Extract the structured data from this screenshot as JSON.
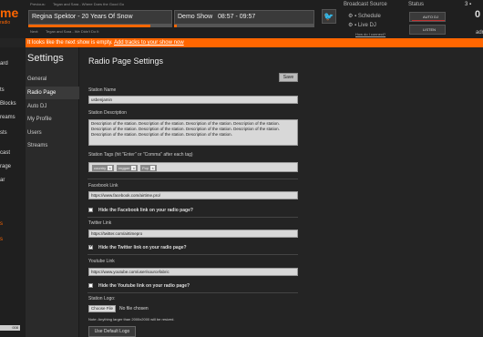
{
  "header": {
    "logo_text": "me",
    "logo_sub": "radio",
    "previous_label": "Previous:",
    "previous_track": "Tegan and Sara - Where Does the Good Go",
    "now_playing": "Regina Spektor - 20 Years Of Snow",
    "now_progress": 0.85,
    "show_name": "Demo Show",
    "show_time": "08:57 - 09:57",
    "show_progress": 0.02,
    "next_label": "Next:",
    "next_track": "Tegan and Sara - We Didn't Do It",
    "twitter_icon": "twitter-icon",
    "broadcast_source_label": "Broadcast Source",
    "schedule_label": "Schedule",
    "live_dj_label": "Live DJ",
    "howto_link": "How do I connect?",
    "status_label": "Status",
    "auto_dj_label": "AUTO DJ",
    "listen_label": "LISTEN",
    "user_count": "3",
    "listener_count": "0",
    "ad_text": "adr"
  },
  "notice": {
    "text": "It looks like the next show is empty.",
    "link": "Add tracks to your show now"
  },
  "sidebar": {
    "items": [
      "ard",
      "",
      "ts",
      "Blocks",
      "reams",
      "sts",
      "",
      "cast",
      "rage",
      "ar",
      "",
      "",
      "s",
      "s"
    ],
    "bottom_value": "008"
  },
  "subnav": {
    "title": "Settings",
    "items": [
      "General",
      "Radio Page",
      "Auto DJ",
      "My Profile",
      "Users",
      "Streams"
    ]
  },
  "page": {
    "title": "Radio Page Settings",
    "save_label": "Save",
    "station_name_label": "Station Name",
    "station_name_value": "usbenjamin",
    "station_description_label": "Station Description",
    "station_description_value": "Description of the station. Description of the station. Description of the station. Description of the station. Description of the station. Description of the station. Description of the station. Description of the station. Description of the station. Description of the station. Description of the station.",
    "station_tags_label": "Station Tags (hit \"Enter\" or \"Comma\" after each tag)",
    "tags": [
      "country",
      "reggae",
      "Pop"
    ],
    "facebook_label": "Facebook Link",
    "facebook_value": "https://www.facebook.com/airtime.pro/",
    "facebook_hide_label": "Hide the Facebook link on your radio page?",
    "twitter_label": "Twitter Link",
    "twitter_value": "https://twitter.com/airtimepro",
    "twitter_hide_label": "Hide the Twitter link on your radio page?",
    "youtube_label": "Youtube Link",
    "youtube_value": "https://www.youtube.com/user/sourcefabric",
    "youtube_hide_label": "Hide the Youtube link on your radio page?",
    "logo_label": "Station Logo:",
    "choose_file_label": "Choose File",
    "no_file_label": "No file chosen",
    "note": "Note: Anything larger than 2000x2000 will be resized.",
    "default_logo_label": "Use Default Logo"
  },
  "colors": {
    "accent": "#ff6600",
    "background": "#242424",
    "panel": "#1f1f1f"
  }
}
